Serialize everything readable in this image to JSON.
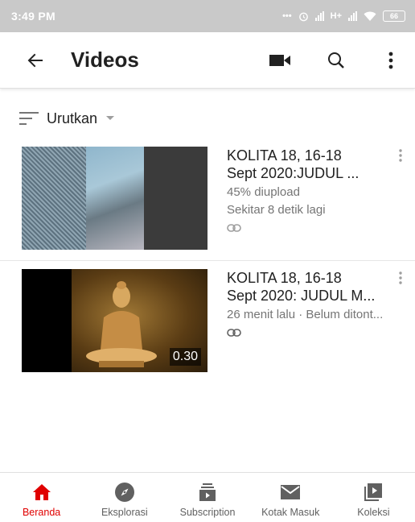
{
  "status_bar": {
    "time": "3:49 PM",
    "network": "H+",
    "battery": "66"
  },
  "app_bar": {
    "title": "Videos"
  },
  "sort": {
    "label": "Urutkan"
  },
  "videos": [
    {
      "title_line1": "KOLITA 18, 16-18",
      "title_line2": "Sept 2020:JUDUL ...",
      "status": "45% diupload",
      "time_left": "Sekitar 8 detik lagi"
    },
    {
      "title_line1": "KOLITA 18, 16-18",
      "title_line2": "Sept 2020: JUDUL M...",
      "meta": "26 menit lalu · Belum ditont...",
      "duration": "0.30"
    }
  ],
  "bottom_nav": {
    "items": [
      {
        "label": "Beranda",
        "icon": "home-icon"
      },
      {
        "label": "Eksplorasi",
        "icon": "compass-icon"
      },
      {
        "label": "Subscription",
        "icon": "subscriptions-icon"
      },
      {
        "label": "Kotak Masuk",
        "icon": "mail-icon"
      },
      {
        "label": "Koleksi",
        "icon": "library-icon"
      }
    ]
  },
  "colors": {
    "accent": "#e00000",
    "text": "#212121",
    "secondary": "#757575",
    "status_bar": "#c9c9c9"
  }
}
